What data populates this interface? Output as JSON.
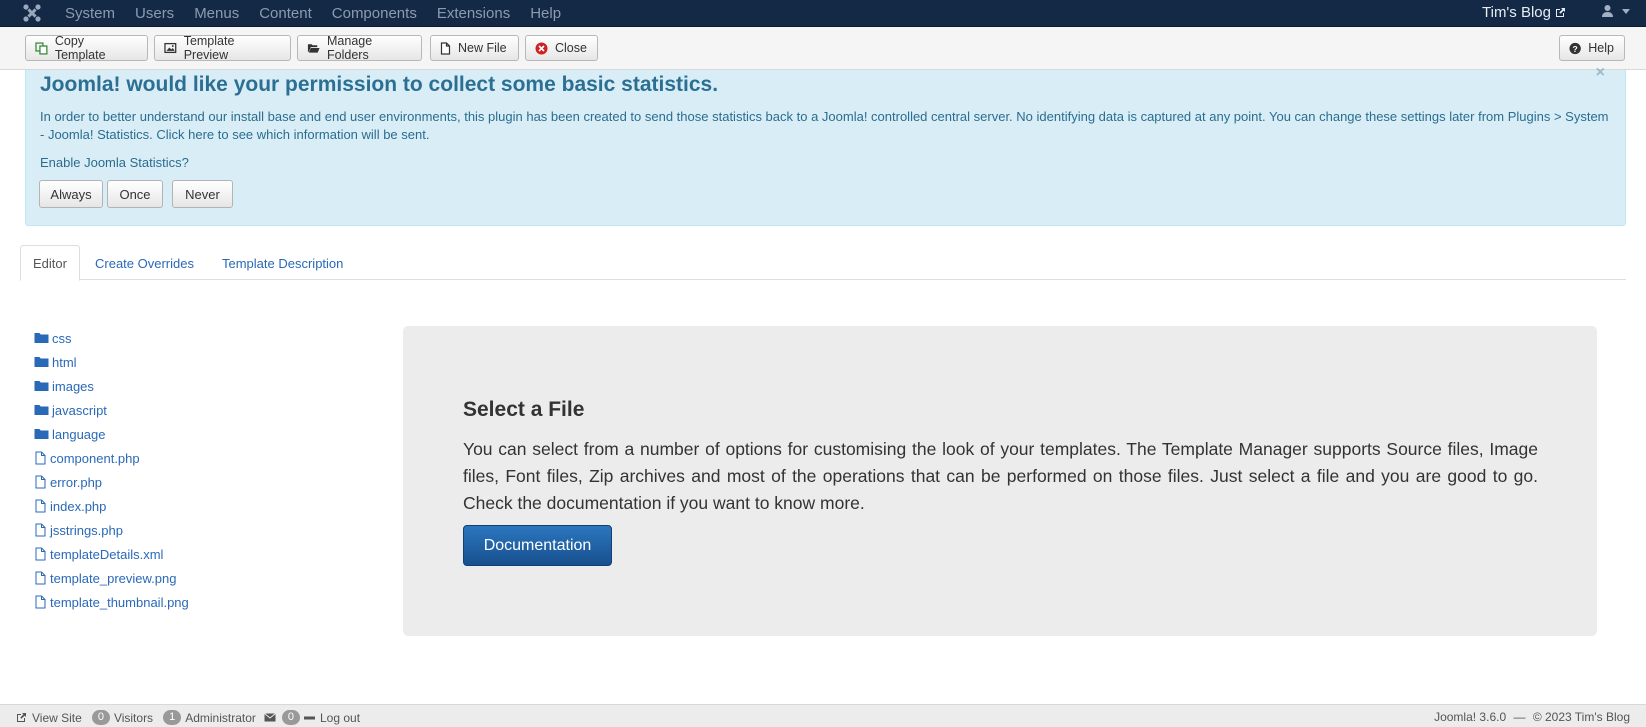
{
  "navbar": {
    "menu": [
      "System",
      "Users",
      "Menus",
      "Content",
      "Components",
      "Extensions",
      "Help"
    ],
    "site_name": "Tim's Blog"
  },
  "toolbar": {
    "copy_template": "Copy Template",
    "template_preview": "Template Preview",
    "manage_folders": "Manage Folders",
    "new_file": "New File",
    "close": "Close",
    "help": "Help"
  },
  "stats_alert": {
    "close": "×",
    "title": "Joomla! would like your permission to collect some basic statistics.",
    "message": "In order to better understand our install base and end user environments, this plugin has been created to send those statistics back to a Joomla! controlled central server. No identifying data is captured at any point. You can change these settings later from Plugins > System - Joomla! Statistics.",
    "link": "Click here to see which information will be sent.",
    "question": "Enable Joomla Statistics?",
    "buttons": [
      "Always",
      "Once",
      "Never"
    ]
  },
  "tabs": [
    "Editor",
    "Create Overrides",
    "Template Description"
  ],
  "file_tree": [
    {
      "name": "css",
      "type": "folder"
    },
    {
      "name": "html",
      "type": "folder"
    },
    {
      "name": "images",
      "type": "folder"
    },
    {
      "name": "javascript",
      "type": "folder"
    },
    {
      "name": "language",
      "type": "folder"
    },
    {
      "name": "component.php",
      "type": "file"
    },
    {
      "name": "error.php",
      "type": "file"
    },
    {
      "name": "index.php",
      "type": "file"
    },
    {
      "name": "jsstrings.php",
      "type": "file"
    },
    {
      "name": "templateDetails.xml",
      "type": "file"
    },
    {
      "name": "template_preview.png",
      "type": "file"
    },
    {
      "name": "template_thumbnail.png",
      "type": "file"
    }
  ],
  "main": {
    "heading": "Select a File",
    "description": "You can select from a number of options for customising the look of your templates. The Template Manager supports Source files, Image files, Font files, Zip archives and most of the operations that can be performed on those files. Just select a file and you are good to go. Check the documentation if you want to know more.",
    "doc_button": "Documentation"
  },
  "footer": {
    "view_site": "View Site",
    "visitors_count": "0",
    "visitors_label": "Visitors",
    "admins_count": "1",
    "admins_label": "Administrator",
    "messages_count": "0",
    "logout": "Log out",
    "version": "Joomla! 3.6.0",
    "copyright": "© 2023 Tim's Blog",
    "separator": "—"
  },
  "colors": {
    "navbar": "#132945",
    "alert_bg": "#d9edf7",
    "link": "#2a69b8",
    "primary_button": "#1f5fa5"
  }
}
